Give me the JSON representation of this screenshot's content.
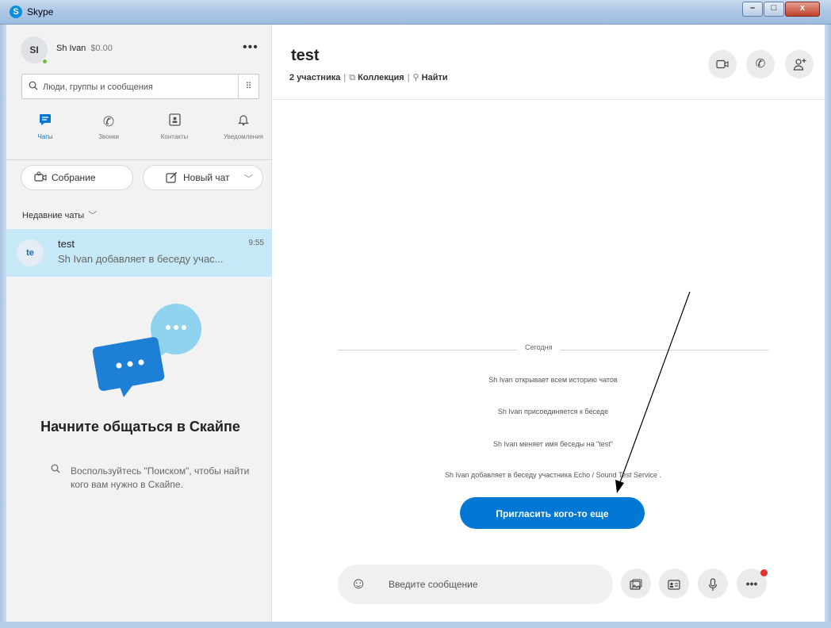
{
  "window": {
    "title": "Skype",
    "minimize_glyph": "–",
    "maximize_glyph": "□",
    "close_glyph": "x"
  },
  "profile": {
    "initials": "SI",
    "name": "Sh Ivan",
    "balance": "$0.00",
    "more": "•••"
  },
  "search": {
    "placeholder": "Люди, группы и сообщения",
    "dialpad": "⠿"
  },
  "nav": [
    {
      "label": "Чаты",
      "icon": "chat-icon",
      "active": true
    },
    {
      "label": "Звонки",
      "icon": "phone-icon",
      "active": false
    },
    {
      "label": "Контакты",
      "icon": "contacts-icon",
      "active": false
    },
    {
      "label": "Уведомления",
      "icon": "bell-icon",
      "active": false
    }
  ],
  "actions": {
    "meet": "Собрание",
    "new_chat": "Новый чат"
  },
  "recent": {
    "header": "Недавние чаты"
  },
  "chats": [
    {
      "avatar": "te",
      "name": "test",
      "time": "9:55",
      "preview": "Sh Ivan добавляет в беседу учас..."
    }
  ],
  "promo": {
    "title": "Начните общаться в Скайпе",
    "text": "Воспользуйтесь \"Поиском\", чтобы найти кого вам нужно в Скайпе."
  },
  "conversation": {
    "title": "test",
    "participants": "2 участника",
    "gallery": "Коллекция",
    "find": "Найти",
    "day_label": "Сегодня",
    "events": [
      "Sh Ivan открывает всем историю чатов",
      "Sh Ivan присоединяется к беседе",
      "Sh Ivan меняет имя беседы на \"test\"",
      "Sh Ivan добавляет в беседу участника Echo / Sound Test Service ."
    ],
    "invite_button": "Пригласить кого-то еще"
  },
  "composer": {
    "placeholder": "Введите сообщение"
  },
  "colors": {
    "accent": "#0078d4",
    "selected_chat": "#c7e9f7",
    "notification": "#e5312b"
  }
}
